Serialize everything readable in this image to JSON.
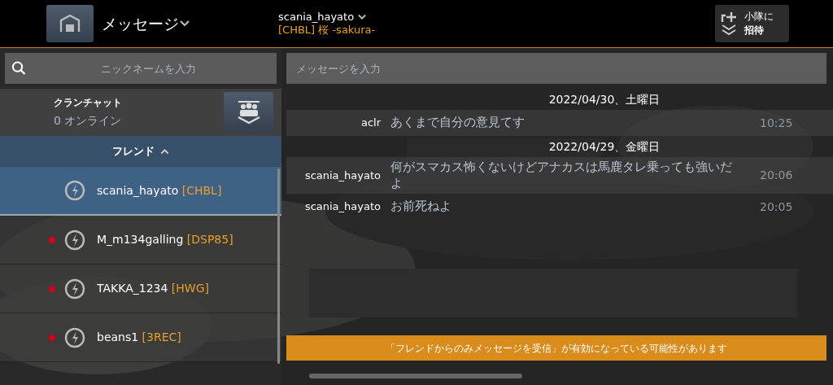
{
  "header": {
    "title": "メッセージ",
    "user": {
      "name": "scania_hayato",
      "clan": "[CHBL] 桜 -sakura-"
    },
    "invite_button": {
      "line_1": "小隊に",
      "line_2": "招待"
    }
  },
  "sidebar": {
    "search": {
      "placeholder": "ニックネームを入力"
    },
    "clan_chat": {
      "title": "クランチャット",
      "online": "0 オンライン"
    },
    "friends_header": "フレンド",
    "friends": [
      {
        "name": "scania_hayato",
        "tag": "[CHBL]",
        "selected": true,
        "unread": false
      },
      {
        "name": "M_m134galling",
        "tag": "[DSP85]",
        "selected": false,
        "unread": true
      },
      {
        "name": "TAKKA_1234",
        "tag": "[HWG]",
        "selected": false,
        "unread": true
      },
      {
        "name": "beans1",
        "tag": "[3REC]",
        "selected": false,
        "unread": true
      }
    ]
  },
  "chat": {
    "input": {
      "placeholder": "メッセージを入力"
    },
    "entries": [
      {
        "kind": "date",
        "text": "2022/04/30、土曜日"
      },
      {
        "kind": "message",
        "sender": "aclr",
        "text": "あくまで自分の意見てす",
        "time": "10:25",
        "highlighted": true
      },
      {
        "kind": "date",
        "text": "2022/04/29、金曜日"
      },
      {
        "kind": "message",
        "sender": "scania_hayato",
        "text": "何がスマカス怖くないけどアナカスは馬鹿タレ乗っても強いだよ",
        "time": "20:06",
        "highlighted": true
      },
      {
        "kind": "message",
        "sender": "scania_hayato",
        "text": "お前死ねよ",
        "time": "20:05",
        "highlighted": false
      }
    ],
    "notice": "「フレンドからのみメッセージを受信」が有効になっている可能性があります"
  }
}
